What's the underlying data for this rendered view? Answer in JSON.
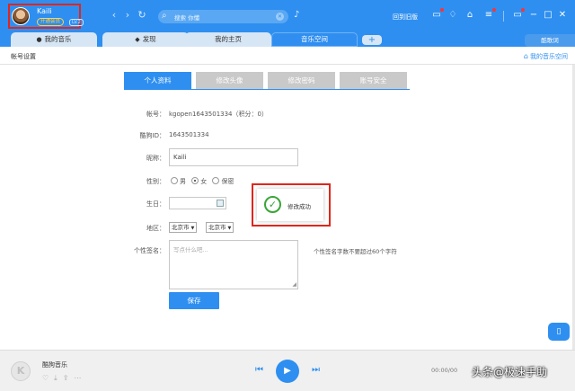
{
  "user": {
    "name": "Kaili",
    "vip_label": "开通会员",
    "level": "LV.2"
  },
  "search": {
    "placeholder": "搜索 你懂"
  },
  "header": {
    "back_to_old": "回到旧版"
  },
  "tabs": [
    {
      "label": "我的音乐",
      "icon": "user-icon"
    },
    {
      "label": "发现",
      "icon": "compass-icon"
    },
    {
      "label": "我的主页",
      "icon": ""
    },
    {
      "label": "音乐空间",
      "icon": "",
      "active": true
    }
  ],
  "ku_ciyu": "酷歌词",
  "subheader": {
    "title": "帐号设置",
    "my_space": "我的音乐空间"
  },
  "account_tabs": [
    {
      "label": "个人资料",
      "active": true
    },
    {
      "label": "修改头像"
    },
    {
      "label": "修改密码"
    },
    {
      "label": "账号安全"
    }
  ],
  "form": {
    "account_label": "帐号：",
    "account_value": "kgopen1643501334（积分：0）",
    "kugou_id_label": "酷狗ID：",
    "kugou_id_value": "1643501334",
    "nickname_label": "昵称：",
    "nickname_value": "Kaili",
    "gender_label": "性别：",
    "gender_options": [
      "男",
      "女",
      "保密"
    ],
    "gender_selected": "女",
    "birthday_label": "生日：",
    "region_label": "地区：",
    "province": "北京市",
    "city": "北京市",
    "signature_label": "个性签名：",
    "signature_placeholder": "写点什么吧...",
    "signature_hint": "个性签名字数不要超过60个字符",
    "save_label": "保存"
  },
  "toast": {
    "message": "修改成功"
  },
  "player": {
    "title": "酷狗音乐",
    "time": "00:00/00",
    "logo_letter": "K"
  },
  "watermark": "头条@极速手助",
  "colors": {
    "primary": "#2e8ff0",
    "highlight": "#e0261b",
    "success": "#3aa537"
  }
}
